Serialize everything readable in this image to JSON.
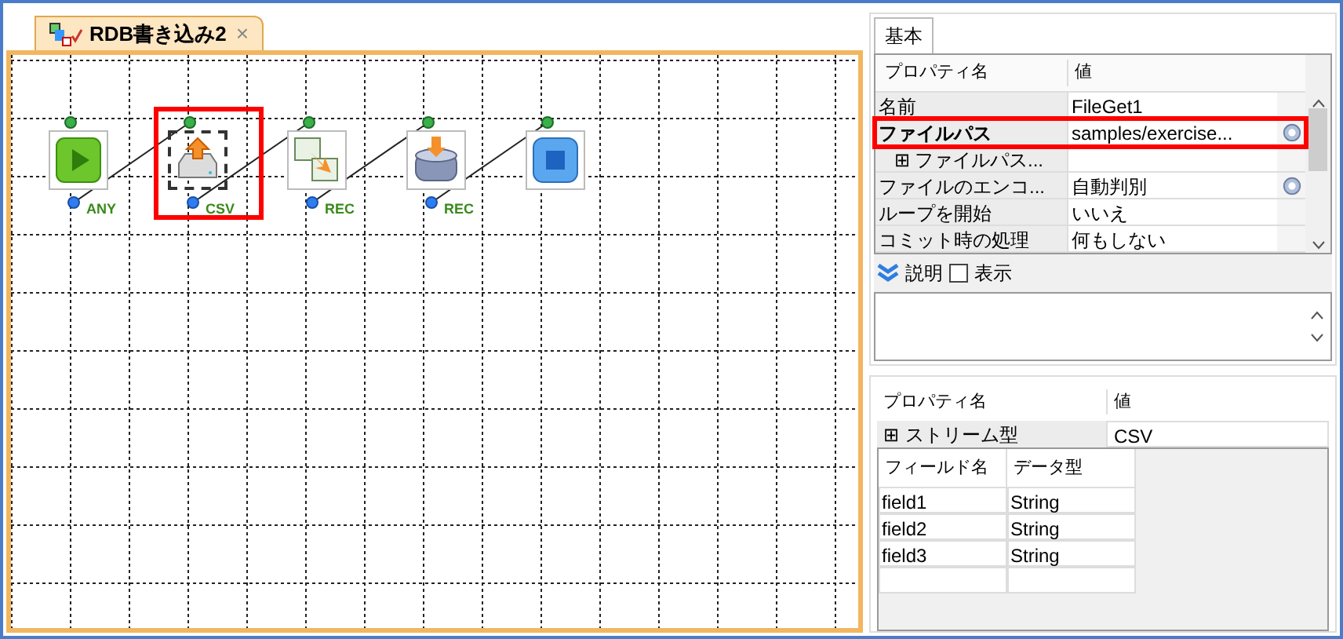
{
  "tab": {
    "title": "RDB書き込み2",
    "close": "×"
  },
  "nodes": [
    {
      "kind": "start",
      "label": "ANY",
      "selected": false
    },
    {
      "kind": "file",
      "label": "CSV",
      "selected": true
    },
    {
      "kind": "convert",
      "label": "REC",
      "selected": false
    },
    {
      "kind": "db",
      "label": "REC",
      "selected": false
    },
    {
      "kind": "end",
      "selected": false
    }
  ],
  "properties": {
    "tab": "基本",
    "columns": [
      "プロパティ名",
      "値"
    ],
    "rows": [
      {
        "name": "名前",
        "value": "FileGet1",
        "highlighted": false,
        "button": false
      },
      {
        "name": "ファイルパス",
        "value": "samples/exercise...",
        "highlighted": true,
        "button": true
      },
      {
        "expander": "⊞",
        "name": "ファイルパス...",
        "highlighted": false,
        "button": false
      },
      {
        "name": "ファイルのエンコ...",
        "value": "自動判別",
        "highlighted": false,
        "button": true
      },
      {
        "name": "ループを開始",
        "value": "いいえ",
        "highlighted": false,
        "button": false
      },
      {
        "name": "コミット時の処理",
        "value": "何もしない",
        "highlighted": false,
        "button": false
      }
    ]
  },
  "description": {
    "label": "説明",
    "show_label": "表示",
    "show_checked": false
  },
  "stream": {
    "columns": [
      "プロパティ名",
      "値"
    ],
    "row": {
      "expander": "⊞",
      "name": "ストリーム型",
      "value": "CSV"
    },
    "fields": {
      "columns": [
        "フィールド名",
        "データ型"
      ],
      "rows": [
        [
          "field1",
          "String"
        ],
        [
          "field2",
          "String"
        ],
        [
          "field3",
          "String"
        ]
      ]
    }
  }
}
